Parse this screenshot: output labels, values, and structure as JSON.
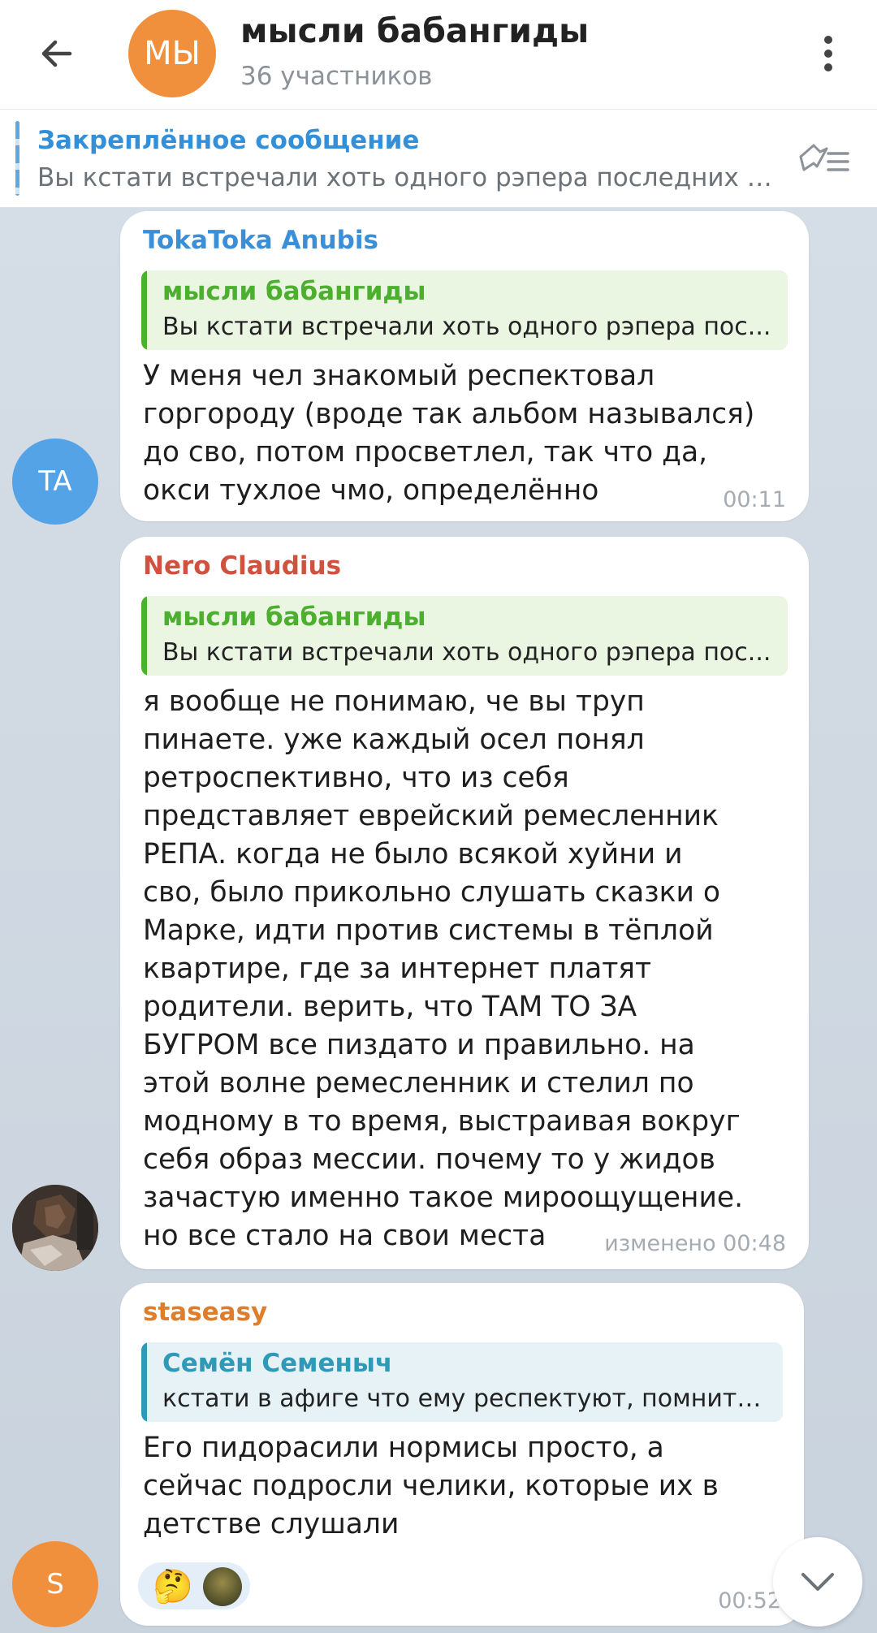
{
  "header": {
    "back_icon": "arrow-left-icon",
    "avatar_initials": "МЫ",
    "avatar_color": "#f1903c",
    "title": "мысли бабангиды",
    "subtitle": "36 участников",
    "menu_icon": "more-vertical-icon"
  },
  "pinned": {
    "title": "Закреплённое сообщение",
    "text": "Вы кстати встречали хоть одного рэпера последних л...",
    "icon": "pinned-list-icon"
  },
  "messages": [
    {
      "sender": "TokaToka Anubis",
      "sender_color": "#3a8fd9",
      "avatar_initials": "TA",
      "avatar_color": "#54a3e6",
      "reply": {
        "name": "мысли бабангиды",
        "text": "Вы кстати встречали хоть одного рэпера пос...",
        "color": "#4caf2e"
      },
      "text": "У меня чел знакомый респектовал\nгоргороду (вроде так альбом назывался)\nдо сво, потом просветлел, так что да,\nокси тухлое чмо, определённо",
      "time": "00:11"
    },
    {
      "sender": "Nero Claudius",
      "sender_color": "#d1513f",
      "avatar_icon": "user-photo-avatar",
      "reply": {
        "name": "мысли бабангиды",
        "text": "Вы кстати встречали хоть одного рэпера пос...",
        "color": "#4caf2e"
      },
      "text": "я вообще не понимаю, че вы труп\nпинаете. уже каждый осел понял\nретроспективно, что из себя\nпредставляет еврейский ремесленник\nРЕПА. когда не было всякой хуйни и\nсво, было прикольно слушать сказки о\nМарке, идти против системы в тёплой\nквартире, где за интернет платят\nродители. верить, что ТАМ ТО ЗА\nБУГРОМ все пиздато и правильно. на\nэтой волне ремесленник и стелил по\nмодному в то время, выстраивая вокруг\nсебя образ мессии. почему то у жидов\nзачастую именно такое мироощущение.\nно все стало на свои места",
      "time": "изменено 00:48"
    },
    {
      "sender": "staseasy",
      "sender_color": "#e07d2a",
      "avatar_initials": "S",
      "avatar_color": "#f1903c",
      "reply": {
        "name": "Семён Семеныч",
        "text": "кстати в афиге что ему респектуют, помнитс...",
        "color": "#2e9ab8"
      },
      "text": "Его пидорасили нормисы просто, а\nсейчас подросли челики, которые их в\nдетстве слушали",
      "reaction_emoji": "🤔",
      "reaction_user_icon": "reactor-avatar",
      "time": "00:52"
    }
  ],
  "scroll_button_icon": "chevron-down-icon"
}
